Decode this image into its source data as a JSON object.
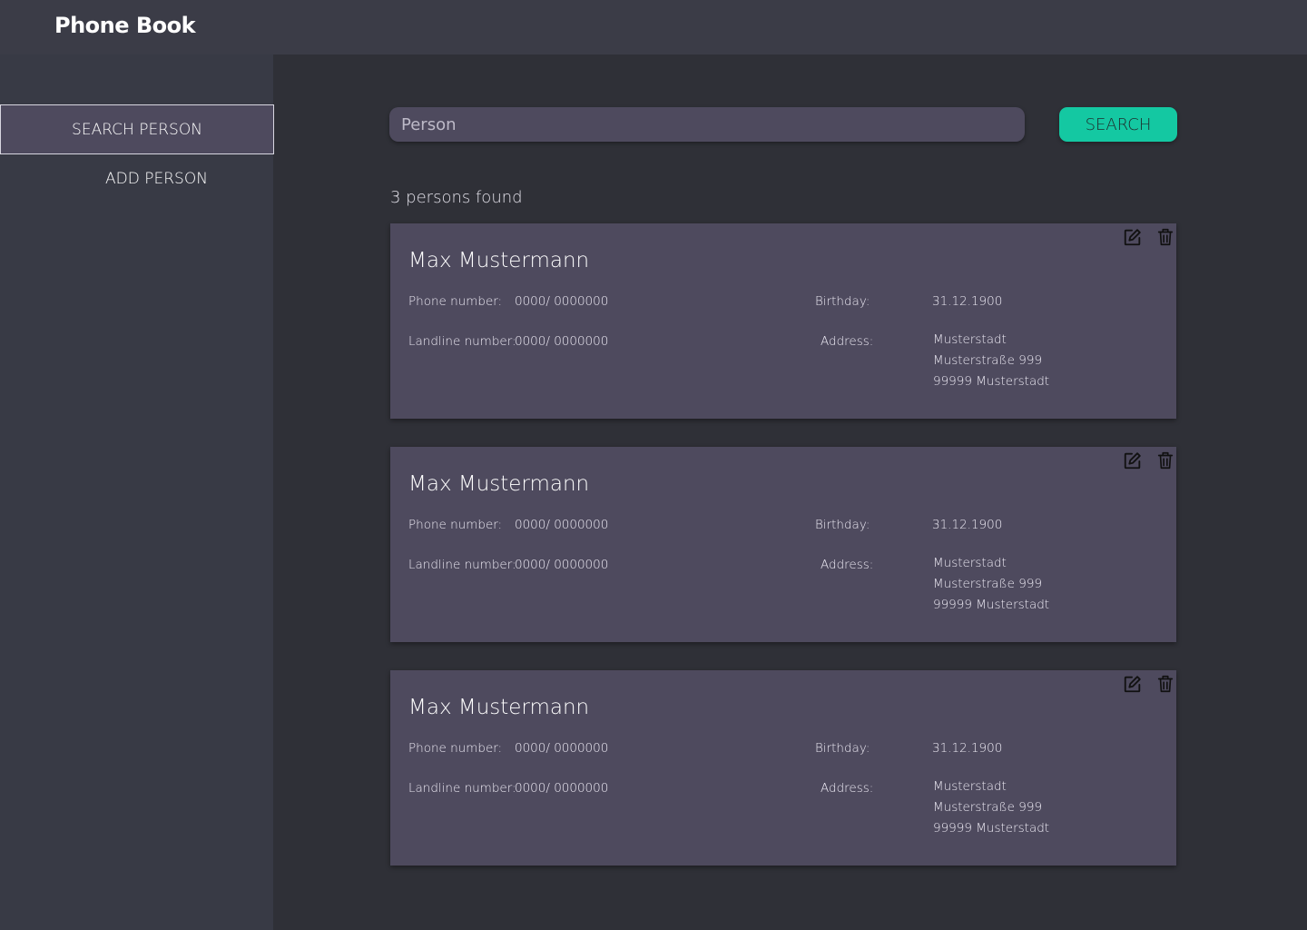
{
  "header": {
    "title": "Phone Book"
  },
  "sidebar": {
    "items": [
      {
        "label": "SEARCH PERSON",
        "active": true
      },
      {
        "label": "ADD PERSON",
        "active": false
      }
    ]
  },
  "search": {
    "placeholder": "Person",
    "button_label": "SEARCH"
  },
  "results": {
    "count_text": "3 persons found",
    "labels": {
      "phone": "Phone number:",
      "landline": "Landline number:",
      "birthday": "Birthday:",
      "address": "Address:"
    },
    "persons": [
      {
        "name": "Max Mustermann",
        "phone": "0000/ 0000000",
        "landline": "0000/ 0000000",
        "birthday": "31.12.1900",
        "address": [
          "Musterstadt",
          "Musterstraße 999",
          "99999 Musterstadt"
        ]
      },
      {
        "name": "Max Mustermann",
        "phone": "0000/ 0000000",
        "landline": "0000/ 0000000",
        "birthday": "31.12.1900",
        "address": [
          "Musterstadt",
          "Musterstraße 999",
          "99999 Musterstadt"
        ]
      },
      {
        "name": "Max Mustermann",
        "phone": "0000/ 0000000",
        "landline": "0000/ 0000000",
        "birthday": "31.12.1900",
        "address": [
          "Musterstadt",
          "Musterstraße 999",
          "99999 Musterstadt"
        ]
      }
    ],
    "actions": {
      "edit_icon": "edit-icon",
      "delete_icon": "trash-icon"
    }
  },
  "colors": {
    "background": "#2f3037",
    "topbar": "#3b3c47",
    "sidebar": "#383a45",
    "card": "#4e4a5e",
    "accent": "#14c8a2"
  }
}
